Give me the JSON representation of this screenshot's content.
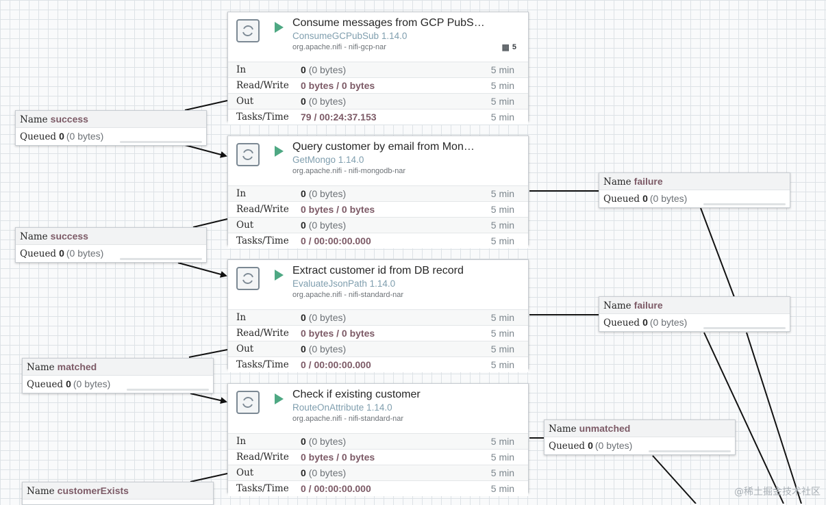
{
  "processors": [
    {
      "name": "Consume messages from GCP PubS…",
      "type": "ConsumeGCPubSub 1.14.0",
      "bundle": "org.apache.nifi - nifi-gcp-nar",
      "threads": "5",
      "in_count": "0",
      "in_bytes": "(0 bytes)",
      "rw": "0 bytes / 0 bytes",
      "out_count": "0",
      "out_bytes": "(0 bytes)",
      "tasks": "79 / 00:24:37.153",
      "window": "5 min"
    },
    {
      "name": "Query customer by email from Mon…",
      "type": "GetMongo 1.14.0",
      "bundle": "org.apache.nifi - nifi-mongodb-nar",
      "in_count": "0",
      "in_bytes": "(0 bytes)",
      "rw": "0 bytes / 0 bytes",
      "out_count": "0",
      "out_bytes": "(0 bytes)",
      "tasks": "0 / 00:00:00.000",
      "window": "5 min"
    },
    {
      "name": "Extract customer id from DB record",
      "type": "EvaluateJsonPath 1.14.0",
      "bundle": "org.apache.nifi - nifi-standard-nar",
      "in_count": "0",
      "in_bytes": "(0 bytes)",
      "rw": "0 bytes / 0 bytes",
      "out_count": "0",
      "out_bytes": "(0 bytes)",
      "tasks": "0 / 00:00:00.000",
      "window": "5 min"
    },
    {
      "name": "Check if existing customer",
      "type": "RouteOnAttribute 1.14.0",
      "bundle": "org.apache.nifi - nifi-standard-nar",
      "in_count": "0",
      "in_bytes": "(0 bytes)",
      "rw": "0 bytes / 0 bytes",
      "out_count": "0",
      "out_bytes": "(0 bytes)",
      "tasks": "0 / 00:00:00.000",
      "window": "5 min"
    }
  ],
  "labels": {
    "in": "In",
    "rw": "Read/Write",
    "out": "Out",
    "tasks": "Tasks/Time",
    "name": "Name",
    "queued": "Queued"
  },
  "connections": [
    {
      "name": "success",
      "count": "0",
      "bytes": "(0 bytes)"
    },
    {
      "name": "success",
      "count": "0",
      "bytes": "(0 bytes)"
    },
    {
      "name": "matched",
      "count": "0",
      "bytes": "(0 bytes)"
    },
    {
      "name": "customerExists",
      "count": "",
      "bytes": ""
    },
    {
      "name": "failure",
      "count": "0",
      "bytes": "(0 bytes)"
    },
    {
      "name": "failure",
      "count": "0",
      "bytes": "(0 bytes)"
    },
    {
      "name": "unmatched",
      "count": "0",
      "bytes": "(0 bytes)"
    }
  ],
  "watermark": "@稀土掘金技术社区",
  "colors": {
    "run": "#4ea883",
    "connection_name": "#7c5a66",
    "type_text": "#7f9eae"
  }
}
